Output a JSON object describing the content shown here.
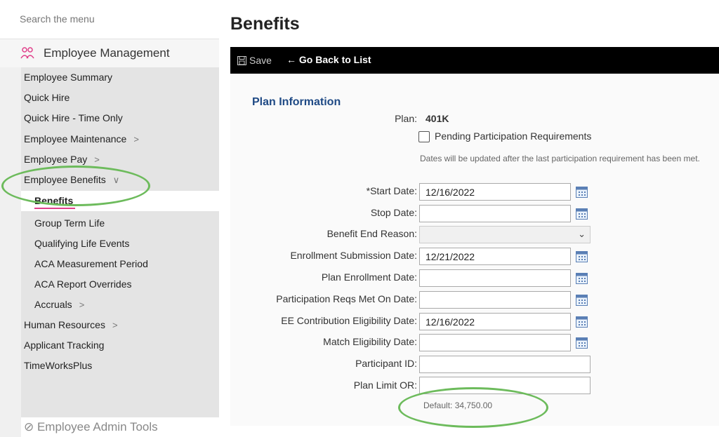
{
  "sidebar": {
    "search_placeholder": "Search the menu",
    "section_title": "Employee Management",
    "items": [
      {
        "label": "Employee Summary"
      },
      {
        "label": "Quick Hire"
      },
      {
        "label": "Quick Hire - Time Only"
      },
      {
        "label": "Employee Maintenance",
        "chevron": ">"
      },
      {
        "label": "Employee Pay",
        "chevron": ">"
      },
      {
        "label": "Employee Benefits",
        "chevron": "∨"
      },
      {
        "label": "Benefits"
      },
      {
        "label": "Group Term Life"
      },
      {
        "label": "Qualifying Life Events"
      },
      {
        "label": "ACA Measurement Period"
      },
      {
        "label": "ACA Report Overrides"
      },
      {
        "label": "Accruals",
        "chevron": ">"
      },
      {
        "label": "Human Resources",
        "chevron": ">"
      },
      {
        "label": "Applicant Tracking"
      },
      {
        "label": "TimeWorksPlus"
      }
    ],
    "bottom_section": "Employee Admin Tools"
  },
  "main": {
    "title": "Benefits",
    "toolbar": {
      "save": "Save",
      "back": "← Go Back to List"
    },
    "section": "Plan Information",
    "plan_label": "Plan:",
    "plan_value": "401K",
    "pending_label": "Pending Participation Requirements",
    "pending_checked": false,
    "note": "Dates will be updated after the last participation requirement has been met.",
    "fields": {
      "start_date": {
        "label": "Start Date:",
        "required": "*",
        "value": "12/16/2022"
      },
      "stop_date": {
        "label": "Stop Date:",
        "value": ""
      },
      "benefit_end_reason": {
        "label": "Benefit End Reason:",
        "value": ""
      },
      "enrollment_submission_date": {
        "label": "Enrollment Submission Date:",
        "value": "12/21/2022"
      },
      "plan_enrollment_date": {
        "label": "Plan Enrollment Date:",
        "value": ""
      },
      "participation_reqs_met": {
        "label": "Participation Reqs Met On Date:",
        "value": ""
      },
      "ee_contribution_eligibility": {
        "label": "EE Contribution Eligibility Date:",
        "value": "12/16/2022"
      },
      "match_eligibility": {
        "label": "Match Eligibility Date:",
        "value": ""
      },
      "participant_id": {
        "label": "Participant ID:",
        "value": ""
      },
      "plan_limit_or": {
        "label": "Plan Limit OR:",
        "value": ""
      }
    },
    "default_note": "Default: 34,750.00"
  },
  "colors": {
    "accent_pink": "#e0408a",
    "heading_blue": "#1f4a85",
    "highlight_green": "#6dbb5c",
    "toolbar_bg": "#000000"
  }
}
